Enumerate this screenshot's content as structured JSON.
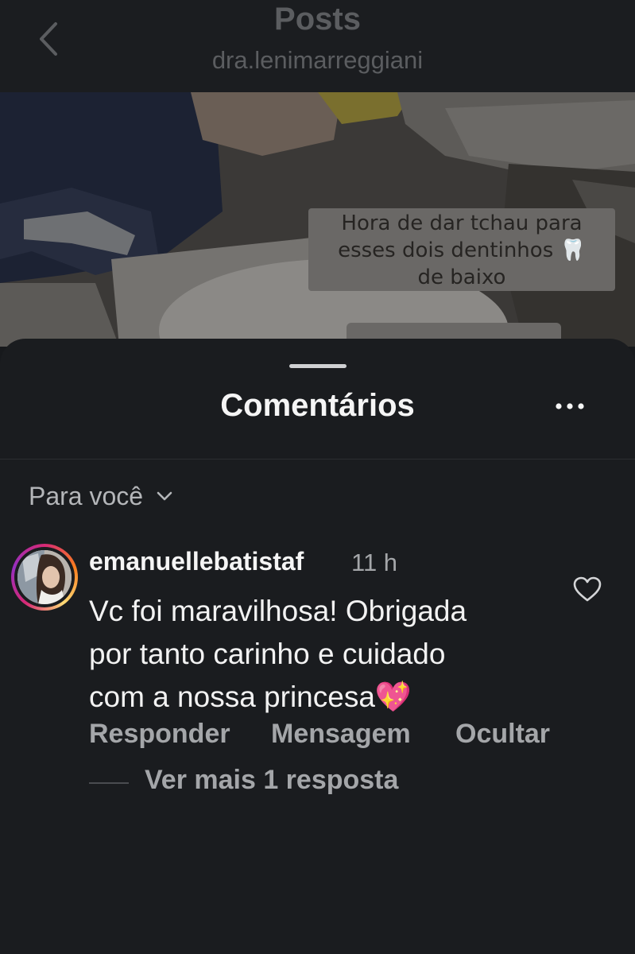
{
  "header": {
    "title": "Posts",
    "subtitle": "dra.lenimarreggiani",
    "back_icon": "chevron-left-icon"
  },
  "post": {
    "caption_lines": [
      "Hora de dar tchau para",
      "esses dois dentinhos 🦷",
      "de baixo"
    ]
  },
  "sheet": {
    "title": "Comentários",
    "more_icon": "more-horizontal-icon",
    "filter_label": "Para você",
    "filter_icon": "chevron-down-icon"
  },
  "comment": {
    "username": "emanuellebatistaf",
    "time": "11 h",
    "text_lines": [
      "Vc foi maravilhosa! Obrigada",
      "por tanto carinho e cuidado",
      "com a nossa princesa💖"
    ],
    "like_icon": "heart-outline-icon",
    "actions": {
      "reply": "Responder",
      "message": "Mensagem",
      "hide": "Ocultar"
    },
    "view_replies": "Ver mais 1 resposta"
  },
  "colors": {
    "background": "#1a1c1f",
    "text_primary": "#f5f5f5",
    "text_secondary": "#a4a6a9",
    "story_ring": [
      "#d62976",
      "#fa7e1e",
      "#feda75",
      "#962fbf"
    ]
  }
}
